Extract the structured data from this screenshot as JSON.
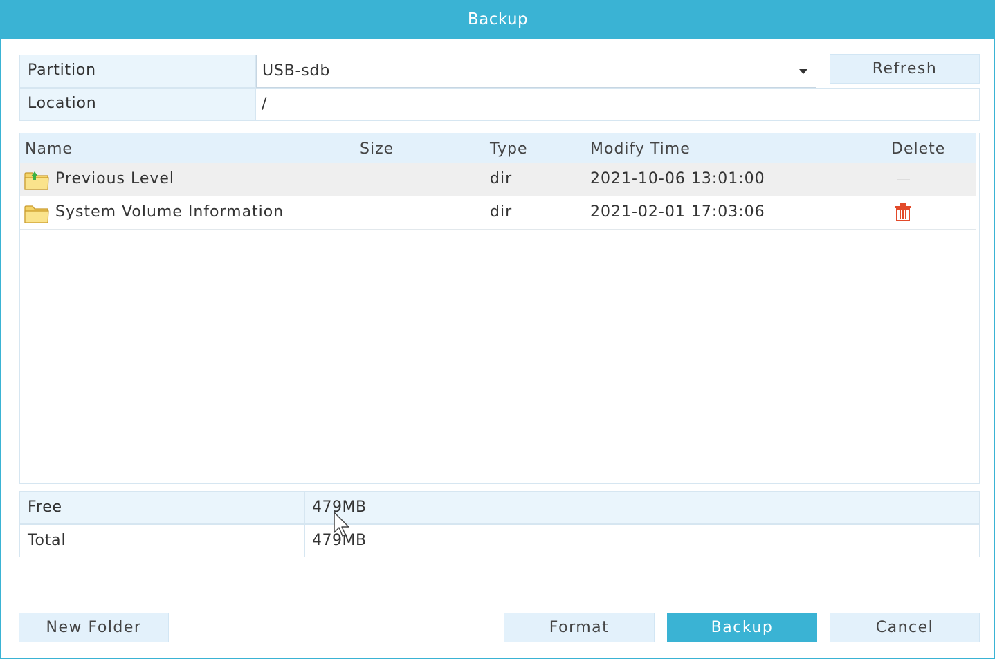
{
  "dialog": {
    "title": "Backup"
  },
  "form": {
    "partition_label": "Partition",
    "partition_value": "USB-sdb",
    "location_label": "Location",
    "location_value": "/",
    "refresh_label": "Refresh"
  },
  "table": {
    "columns": [
      "Name",
      "Size",
      "Type",
      "Modify Time",
      "Delete"
    ],
    "rows": [
      {
        "name": "Previous Level",
        "size": "",
        "type": "dir",
        "modify_time": "2021-10-06 13:01:00",
        "icon": "folder-up-icon",
        "delete": "none"
      },
      {
        "name": "System Volume Information",
        "size": "",
        "type": "dir",
        "modify_time": "2021-02-01 17:03:06",
        "icon": "folder-icon",
        "delete": "trash-icon"
      }
    ]
  },
  "storage": {
    "free_label": "Free",
    "free_value": "479MB",
    "total_label": "Total",
    "total_value": "479MB"
  },
  "buttons": {
    "new_folder": "New Folder",
    "format": "Format",
    "backup": "Backup",
    "cancel": "Cancel"
  },
  "colors": {
    "accent": "#3ab3d4",
    "header_bg": "#e3f1fb",
    "delete_icon": "#e24a2a"
  }
}
